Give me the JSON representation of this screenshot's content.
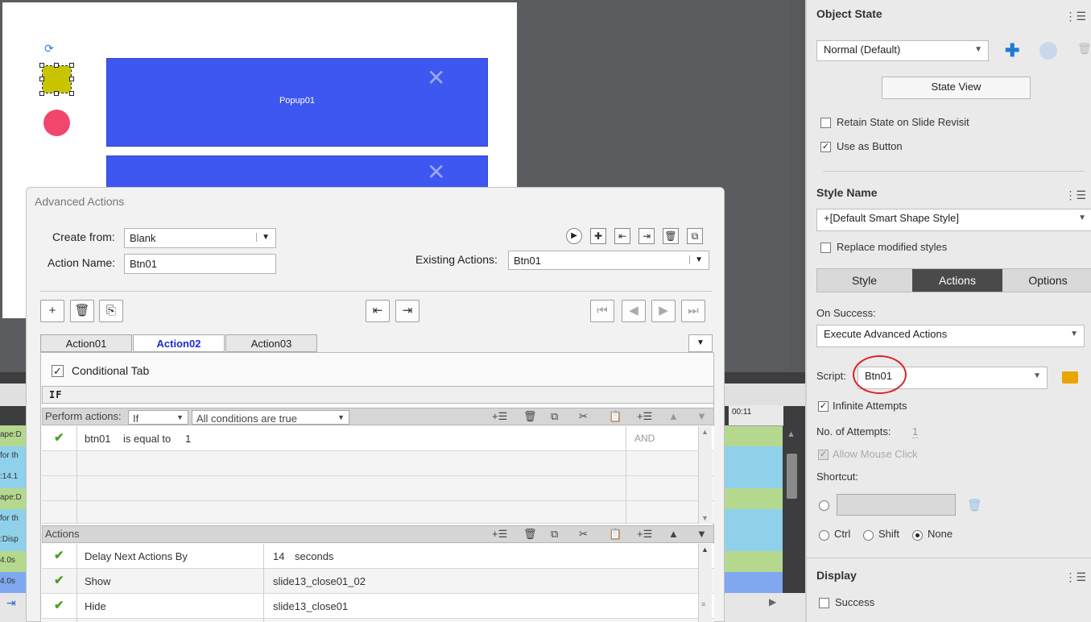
{
  "stage": {
    "popup_label": "Popup01",
    "close_glyph": "✕"
  },
  "timeline": {
    "left_labels": [
      "ape:D",
      "for th",
      ":14.1",
      "ape:D",
      "for th",
      ":Disp",
      "4.0s",
      "4.0s"
    ],
    "ruler_label": "00:11"
  },
  "dialog": {
    "title": "Advanced Actions",
    "create_from_label": "Create from:",
    "create_from_value": "Blank",
    "action_name_label": "Action Name:",
    "action_name_value": "Btn01",
    "existing_actions_label": "Existing Actions:",
    "existing_actions_value": "Btn01",
    "tabs": [
      "Action01",
      "Action02",
      "Action03"
    ],
    "conditional_tab_label": "Conditional Tab",
    "if_label": "IF",
    "perform_actions_label": "Perform actions:",
    "perform_if_value": "If",
    "conditions_value": "All conditions are true",
    "conditions": [
      {
        "variable": "btn01",
        "operator": "is equal to",
        "value": "1",
        "logic": "AND"
      }
    ],
    "actions_label": "Actions",
    "actions": [
      {
        "action": "Delay Next Actions By",
        "target": "14",
        "unit": "seconds"
      },
      {
        "action": "Show",
        "target": "slide13_close01_02",
        "unit": ""
      },
      {
        "action": "Hide",
        "target": "slide13_close01",
        "unit": ""
      }
    ]
  },
  "props": {
    "object_state_title": "Object State",
    "state_value": "Normal (Default)",
    "state_view_label": "State View",
    "retain_state_label": "Retain State on Slide Revisit",
    "use_as_button_label": "Use as Button",
    "style_name_title": "Style Name",
    "style_value": "+[Default Smart Shape Style]",
    "replace_styles_label": "Replace modified styles",
    "tabs": [
      "Style",
      "Actions",
      "Options"
    ],
    "on_success_label": "On Success:",
    "on_success_value": "Execute Advanced Actions",
    "script_label": "Script:",
    "script_value": "Btn01",
    "infinite_attempts_label": "Infinite Attempts",
    "attempts_label": "No. of Attempts:",
    "attempts_value": "1",
    "allow_mouse_click_label": "Allow Mouse Click",
    "shortcut_label": "Shortcut:",
    "modifier_options": [
      "Ctrl",
      "Shift",
      "None"
    ],
    "display_title": "Display",
    "success_label": "Success"
  },
  "colors": {
    "popup_blue": "#3e57f0",
    "accent_blue": "#1a2bd0",
    "check_green": "#4aa02c",
    "annotation_red": "#dd2222",
    "folder_yellow": "#e8a500"
  }
}
